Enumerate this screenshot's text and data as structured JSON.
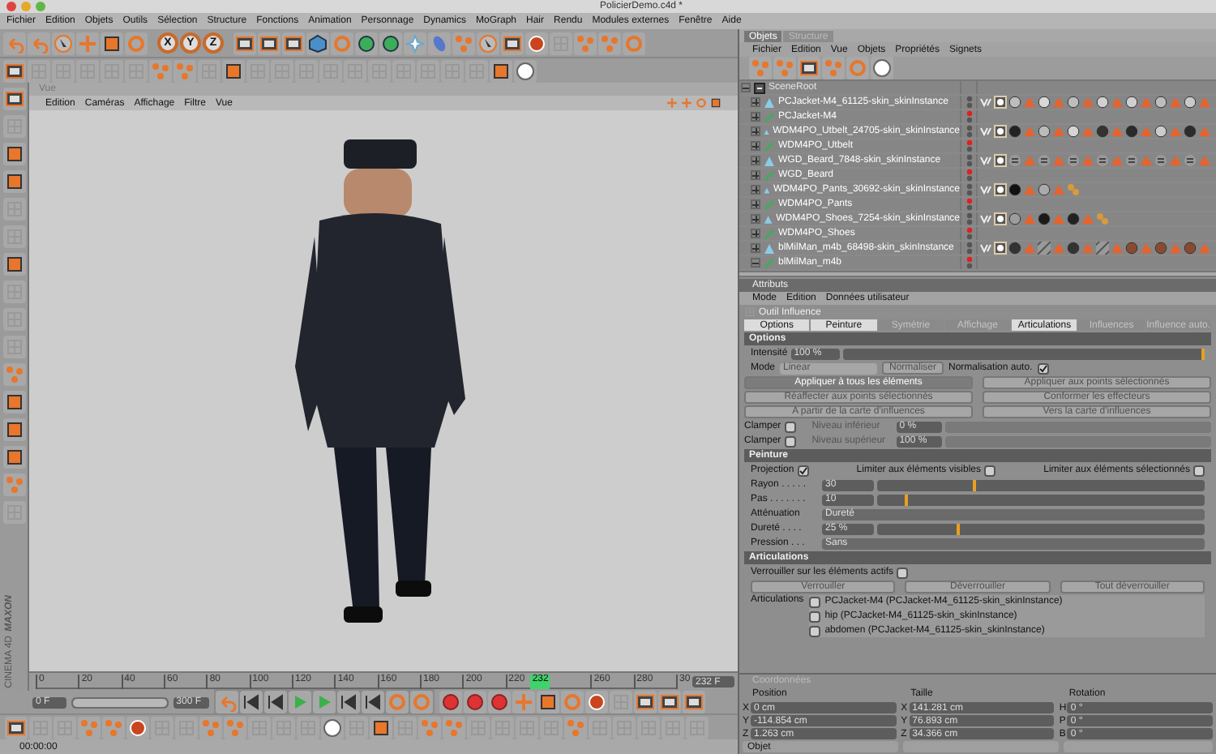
{
  "window": {
    "title": "PolicierDemo.c4d *"
  },
  "menu": [
    "Fichier",
    "Edition",
    "Objets",
    "Outils",
    "Sélection",
    "Structure",
    "Fonctions",
    "Animation",
    "Personnage",
    "Dynamics",
    "MoGraph",
    "Hair",
    "Rendu",
    "Modules externes",
    "Fenêtre",
    "Aide"
  ],
  "axis_buttons": [
    "X",
    "Y",
    "Z"
  ],
  "viewport": {
    "title": "Vue",
    "menu": [
      "Edition",
      "Caméras",
      "Affichage",
      "Filtre",
      "Vue"
    ]
  },
  "logo": [
    "MAXON",
    "CINEMA 4D"
  ],
  "timeline": {
    "ticks": [
      "0",
      "20",
      "40",
      "60",
      "80",
      "100",
      "120",
      "140",
      "160",
      "180",
      "200",
      "220",
      "260",
      "280",
      "30"
    ],
    "current": "232",
    "level": 0.773,
    "frame_field": "232 F",
    "range": {
      "level": 1.0
    },
    "start_field": "0 F",
    "end_field": "300 F"
  },
  "status": "00:00:00",
  "objects": {
    "tabs": [
      {
        "label": "Objets",
        "selected": true
      },
      {
        "label": "Structure",
        "selected": false
      }
    ],
    "menu": [
      "Fichier",
      "Edition",
      "Vue",
      "Objets",
      "Propriétés",
      "Signets"
    ],
    "tree": [
      {
        "name": "SceneRoot",
        "kind": "root",
        "expanded": true,
        "children": [
          {
            "name": "PCJacket-M4_61125-skin_skinInstance",
            "kind": "instance",
            "expanded": false,
            "visible": true,
            "tags": [
              {
                "kind": "uvw"
              },
              {
                "kind": "weight"
              },
              {
                "kind": "material",
                "color": "#bdbdbd"
              },
              {
                "kind": "selection"
              },
              {
                "kind": "material",
                "color": "#d8d8d8"
              },
              {
                "kind": "selection"
              },
              {
                "kind": "material",
                "color": "#bdbdbd"
              },
              {
                "kind": "selection"
              },
              {
                "kind": "material",
                "color": "#d0d0d0"
              },
              {
                "kind": "selection"
              },
              {
                "kind": "material",
                "color": "#cfcfcf"
              },
              {
                "kind": "selection"
              },
              {
                "kind": "material",
                "color": "#bdbdbd"
              },
              {
                "kind": "selection"
              },
              {
                "kind": "material",
                "color": "#c9c9c9"
              },
              {
                "kind": "selection"
              }
            ]
          },
          {
            "name": "PCJacket-M4",
            "kind": "object",
            "expanded": false,
            "visible": false
          },
          {
            "name": "WDM4PO_Utbelt_24705-skin_skinInstance",
            "kind": "instance",
            "expanded": false,
            "visible": true,
            "tags": [
              {
                "kind": "uvw"
              },
              {
                "kind": "weight"
              },
              {
                "kind": "material",
                "color": "#222222"
              },
              {
                "kind": "selection"
              },
              {
                "kind": "material",
                "color": "#bbbbbb"
              },
              {
                "kind": "selection"
              },
              {
                "kind": "material",
                "color": "#d5d5d5"
              },
              {
                "kind": "selection"
              },
              {
                "kind": "material",
                "color": "#333333"
              },
              {
                "kind": "selection"
              },
              {
                "kind": "material",
                "color": "#2a2a2a"
              },
              {
                "kind": "selection"
              },
              {
                "kind": "material",
                "color": "#cccccc"
              },
              {
                "kind": "selection"
              },
              {
                "kind": "material",
                "color": "#2c2c2c"
              },
              {
                "kind": "selection"
              }
            ]
          },
          {
            "name": "WDM4PO_Utbelt",
            "kind": "object",
            "expanded": false,
            "visible": false
          },
          {
            "name": "WGD_Beard_7848-skin_skinInstance",
            "kind": "instance",
            "expanded": false,
            "visible": true,
            "tags": [
              {
                "kind": "uvw"
              },
              {
                "kind": "weight"
              },
              {
                "kind": "pattern"
              },
              {
                "kind": "selection"
              },
              {
                "kind": "pattern"
              },
              {
                "kind": "selection"
              },
              {
                "kind": "pattern"
              },
              {
                "kind": "selection"
              },
              {
                "kind": "pattern"
              },
              {
                "kind": "selection"
              },
              {
                "kind": "pattern"
              },
              {
                "kind": "selection"
              },
              {
                "kind": "pattern"
              },
              {
                "kind": "selection"
              },
              {
                "kind": "pattern"
              },
              {
                "kind": "selection"
              }
            ]
          },
          {
            "name": "WGD_Beard",
            "kind": "object",
            "expanded": false,
            "visible": false
          },
          {
            "name": "WDM4PO_Pants_30692-skin_skinInstance",
            "kind": "instance",
            "expanded": false,
            "visible": true,
            "tags": [
              {
                "kind": "uvw"
              },
              {
                "kind": "weight"
              },
              {
                "kind": "material",
                "color": "#111111"
              },
              {
                "kind": "selection"
              },
              {
                "kind": "material",
                "color": "#aaaaaa"
              },
              {
                "kind": "selection"
              },
              {
                "kind": "joint"
              }
            ]
          },
          {
            "name": "WDM4PO_Pants",
            "kind": "object",
            "expanded": false,
            "visible": false
          },
          {
            "name": "WDM4PO_Shoes_7254-skin_skinInstance",
            "kind": "instance",
            "expanded": false,
            "visible": true,
            "tags": [
              {
                "kind": "uvw"
              },
              {
                "kind": "weight"
              },
              {
                "kind": "material",
                "color": "#9c9c9c"
              },
              {
                "kind": "selection"
              },
              {
                "kind": "material",
                "color": "#1a1a1a"
              },
              {
                "kind": "selection"
              },
              {
                "kind": "material",
                "color": "#222222"
              },
              {
                "kind": "selection"
              },
              {
                "kind": "joint"
              }
            ]
          },
          {
            "name": "WDM4PO_Shoes",
            "kind": "object",
            "expanded": false,
            "visible": false
          },
          {
            "name": "blMilMan_m4b_68498-skin_skinInstance",
            "kind": "instance",
            "expanded": false,
            "visible": true,
            "tags": [
              {
                "kind": "uvw"
              },
              {
                "kind": "weight"
              },
              {
                "kind": "material",
                "color": "#333333"
              },
              {
                "kind": "selection"
              },
              {
                "kind": "stripes"
              },
              {
                "kind": "selection"
              },
              {
                "kind": "material",
                "color": "#333333"
              },
              {
                "kind": "selection"
              },
              {
                "kind": "stripes"
              },
              {
                "kind": "selection"
              },
              {
                "kind": "material",
                "color": "#8a4a30"
              },
              {
                "kind": "selection"
              },
              {
                "kind": "material",
                "color": "#8a4a30"
              },
              {
                "kind": "selection"
              },
              {
                "kind": "material",
                "color": "#8a4a30"
              },
              {
                "kind": "selection"
              }
            ]
          },
          {
            "name": "blMilMan_m4b",
            "kind": "object",
            "expanded": true,
            "visible": false
          }
        ]
      }
    ]
  },
  "attributes": {
    "title": "Attributs",
    "menu": [
      "Mode",
      "Edition",
      "Données utilisateur"
    ],
    "tool": "Outil Influence",
    "tabs": [
      {
        "label": "Options",
        "selected": true
      },
      {
        "label": "Peinture",
        "selected": true
      },
      {
        "label": "Symétrie",
        "selected": false
      },
      {
        "label": "Affichage",
        "selected": false
      },
      {
        "label": "Articulations",
        "selected": true
      },
      {
        "label": "Influences",
        "selected": false
      },
      {
        "label": "Influence auto.",
        "selected": false
      }
    ],
    "options": {
      "title": "Options",
      "intensity": {
        "label": "Intensité",
        "value": "100 %",
        "level": 1.0
      },
      "mode": {
        "label": "Mode",
        "value": "Linear",
        "disabled": true
      },
      "normalize": {
        "label": "Normaliser",
        "disabled": true
      },
      "auto_normalize": {
        "label": "Normalisation auto.",
        "checked": true
      },
      "buttons": [
        {
          "label": "Appliquer à tous les éléments",
          "disabled": false
        },
        {
          "label": "Appliquer aux points sélectionnés",
          "disabled": true
        },
        {
          "label": "Réaffecter aux points sélectionnés",
          "disabled": true
        },
        {
          "label": "Conformer les effecteurs",
          "disabled": true
        },
        {
          "label": "A partir de la carte d'influences",
          "disabled": true
        },
        {
          "label": "Vers la carte d'influences",
          "disabled": true
        }
      ],
      "clamps": [
        {
          "label": "Clamper",
          "checked": false,
          "level_label": "Niveau inférieur",
          "value": "0 %"
        },
        {
          "label": "Clamper",
          "checked": false,
          "level_label": "Niveau supérieur",
          "value": "100 %"
        }
      ]
    },
    "painting": {
      "title": "Peinture",
      "checks": [
        {
          "label": "Projection",
          "checked": true
        },
        {
          "label": "Limiter aux éléments visibles",
          "checked": false
        },
        {
          "label": "Limiter aux éléments sélectionnés",
          "checked": false
        }
      ],
      "fields": [
        {
          "kind": "slider",
          "label": "Rayon . . . . .",
          "value": "30",
          "level": 0.3
        },
        {
          "kind": "slider",
          "label": "Pas . . . . . . .",
          "value": "10",
          "level": 0.095
        },
        {
          "kind": "dropdown",
          "label": "Atténuation",
          "value": "Dureté"
        },
        {
          "kind": "slider",
          "label": "Dureté . . . .",
          "value": "25 %",
          "level": 0.25
        },
        {
          "kind": "dropdown",
          "label": "Pression . . .",
          "value": "Sans"
        }
      ]
    },
    "joints": {
      "title": "Articulations",
      "lock": {
        "label": "Verrouiller sur les éléments actifs",
        "checked": false
      },
      "buttons": [
        {
          "label": "Verrouiller",
          "disabled": true
        },
        {
          "label": "Déverrouiller",
          "disabled": true
        },
        {
          "label": "Tout déverrouiller",
          "disabled": true
        }
      ],
      "list_label": "Articulations",
      "items": [
        {
          "name": "PCJacket-M4 (PCJacket-M4_61125-skin_skinInstance)",
          "checked": false
        },
        {
          "name": "hip (PCJacket-M4_61125-skin_skinInstance)",
          "checked": false
        },
        {
          "name": "abdomen (PCJacket-M4_61125-skin_skinInstance)",
          "checked": false
        }
      ]
    }
  },
  "coordinates": {
    "title": "Coordonnées",
    "columns": [
      {
        "title": "Position",
        "rows": [
          {
            "axis": "X",
            "value": "0 cm"
          },
          {
            "axis": "Y",
            "value": "-114.854 cm"
          },
          {
            "axis": "Z",
            "value": "1.263 cm"
          }
        ]
      },
      {
        "title": "Taille",
        "rows": [
          {
            "axis": "X",
            "value": "141.281 cm"
          },
          {
            "axis": "Y",
            "value": "76.893 cm"
          },
          {
            "axis": "Z",
            "value": "34.366 cm"
          }
        ]
      },
      {
        "title": "Rotation",
        "rows": [
          {
            "axis": "H",
            "value": "0 °"
          },
          {
            "axis": "P",
            "value": "0 °"
          },
          {
            "axis": "B",
            "value": "0 °"
          }
        ]
      }
    ],
    "mode": "Objet"
  }
}
